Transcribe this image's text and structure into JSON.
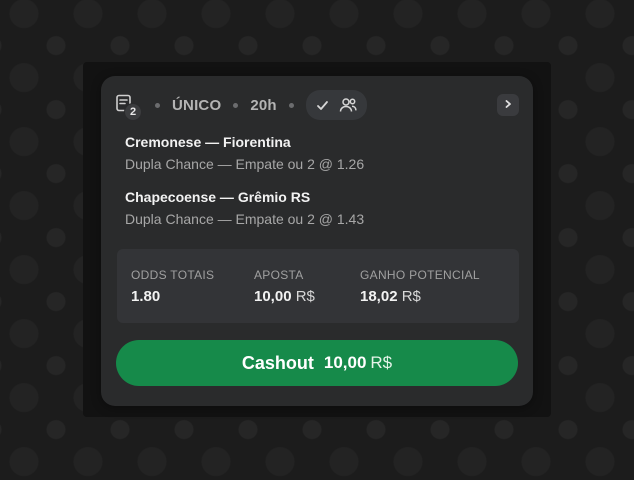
{
  "header": {
    "bet_count": "2",
    "bet_type": "ÚNICO",
    "time": "20h",
    "icons": [
      "bet-slip-icon",
      "check-icon",
      "users-icon",
      "chevron-right-icon"
    ]
  },
  "selections": [
    {
      "match": "Cremonese — Fiorentina",
      "market": "Dupla Chance — Empate ou 2 @ 1.26"
    },
    {
      "match": "Chapecoense — Grêmio RS",
      "market": "Dupla Chance — Empate ou 2 @ 1.43"
    }
  ],
  "summary": {
    "odds_label": "ODDS TOTAIS",
    "odds_value": "1.80",
    "stake_label": "APOSTA",
    "stake_value": "10,00",
    "stake_currency": "R$",
    "payout_label": "GANHO POTENCIAL",
    "payout_value": "18,02",
    "payout_currency": "R$"
  },
  "cashout": {
    "label": "Cashout",
    "amount": "10,00",
    "currency": "R$"
  },
  "colors": {
    "card_bg": "#2a2b2c",
    "summary_bg": "#333437",
    "cashout_green": "#168a4a"
  }
}
